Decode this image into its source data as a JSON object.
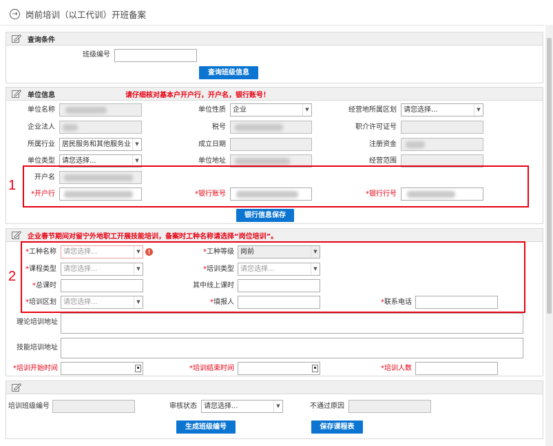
{
  "page": {
    "title": "岗前培训（以工代训）开班备案"
  },
  "query": {
    "section_title": "查询条件",
    "class_no_label": "班级编号",
    "class_no_value": "",
    "search_button": "查询班级信息"
  },
  "unit": {
    "section_title": "单位信息",
    "warning": "请仔细核对基本户开户行，开户名，银行账号！",
    "name_label": "单位名称",
    "nature_label": "单位性质",
    "nature_value": "企业",
    "region_label": "经营地所属区划",
    "region_value": "请您选择...",
    "legal_label": "企业法人",
    "tax_label": "税号",
    "license_label": "职介许可证号",
    "industry_label": "所属行业",
    "industry_value": "居民服务和其他服务业",
    "found_label": "成立日期",
    "capital_label": "注册资金",
    "type_label": "单位类型",
    "type_value": "请您选择...",
    "address_label": "单位地址",
    "scope_label": "经营范围",
    "account_name_label": "开户名",
    "bank_label": "*开户行",
    "account_no_label": "*银行账号",
    "bank_code_label": "*银行行号",
    "save_button": "银行信息保存",
    "box_number": "1"
  },
  "training": {
    "warning": "企业春节期间对留宁外地职工开展技能培训，备案时工种名称请选择“岗位培训”。",
    "box_number": "2",
    "job_name_label": "工种名称",
    "job_name_value": "请您选择...",
    "job_level_label": "工种等级",
    "job_level_value": "岗前",
    "course_type_label": "课程类型",
    "course_type_value": "请您选择...",
    "train_type_label": "培训类型",
    "train_type_value": "请您选择...",
    "total_hours_label": "总课时",
    "online_hours_label": "其中线上课时",
    "district_label": "培训区划",
    "district_value": "请您选择...",
    "reporter_label": "填报人",
    "phone_label": "联系电话",
    "theory_addr_label": "理论培训地址",
    "skill_addr_label": "技能培训地址",
    "start_label": "*培训开始时间",
    "end_label": "*培训结束时间",
    "count_label": "*培训人数",
    "error_mark": "!"
  },
  "audit": {
    "class_no_label": "培训班级编号",
    "status_label": "审核状态",
    "status_value": "请您选择...",
    "reason_label": "不通过原因",
    "generate_button": "生成班级编号",
    "save_button": "保存课程表"
  },
  "colors": {
    "accent": "#0b75d1",
    "warning": "#e60012"
  }
}
